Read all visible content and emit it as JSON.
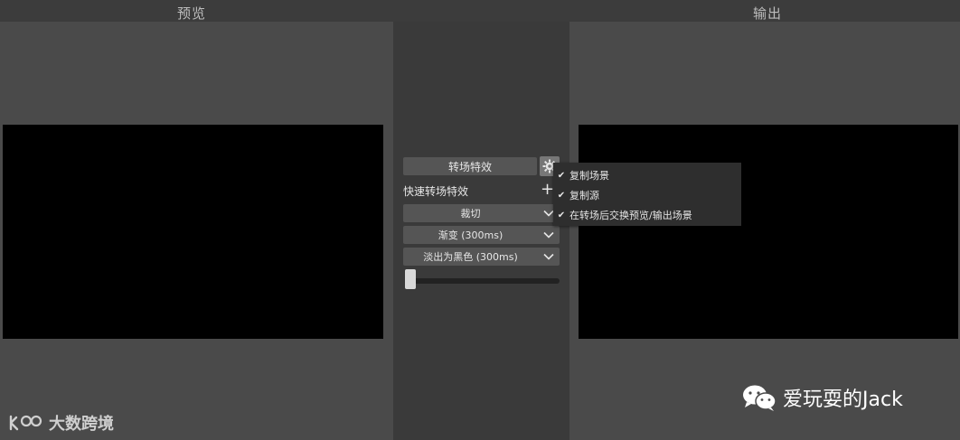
{
  "panels": {
    "preview_label": "预览",
    "output_label": "输出"
  },
  "transitions": {
    "transitions_button_label": "转场特效",
    "quick_transitions_label": "快速转场特效",
    "selects": [
      {
        "value": "裁切"
      },
      {
        "value": "渐变 (300ms)"
      },
      {
        "value": "淡出为黑色 (300ms)"
      }
    ],
    "slider_value": 0
  },
  "context_menu": {
    "items": [
      {
        "label": "复制场景",
        "checked": true
      },
      {
        "label": "复制源",
        "checked": true
      },
      {
        "label": "在转场后交换预览/输出场景",
        "checked": true
      }
    ]
  },
  "watermarks": {
    "left_text": "大数跨境",
    "right_text": "爱玩耍的Jack"
  },
  "icons": {
    "gear": "gear-icon",
    "plus": "plus-icon",
    "chevron": "chevron-down-icon",
    "check": "check-icon",
    "wechat": "wechat-icon"
  },
  "colors": {
    "panel_bg": "#4a4a4a",
    "canvas_bg": "#000000",
    "button_bg": "#555555",
    "menu_bg": "#2e2e2e"
  }
}
